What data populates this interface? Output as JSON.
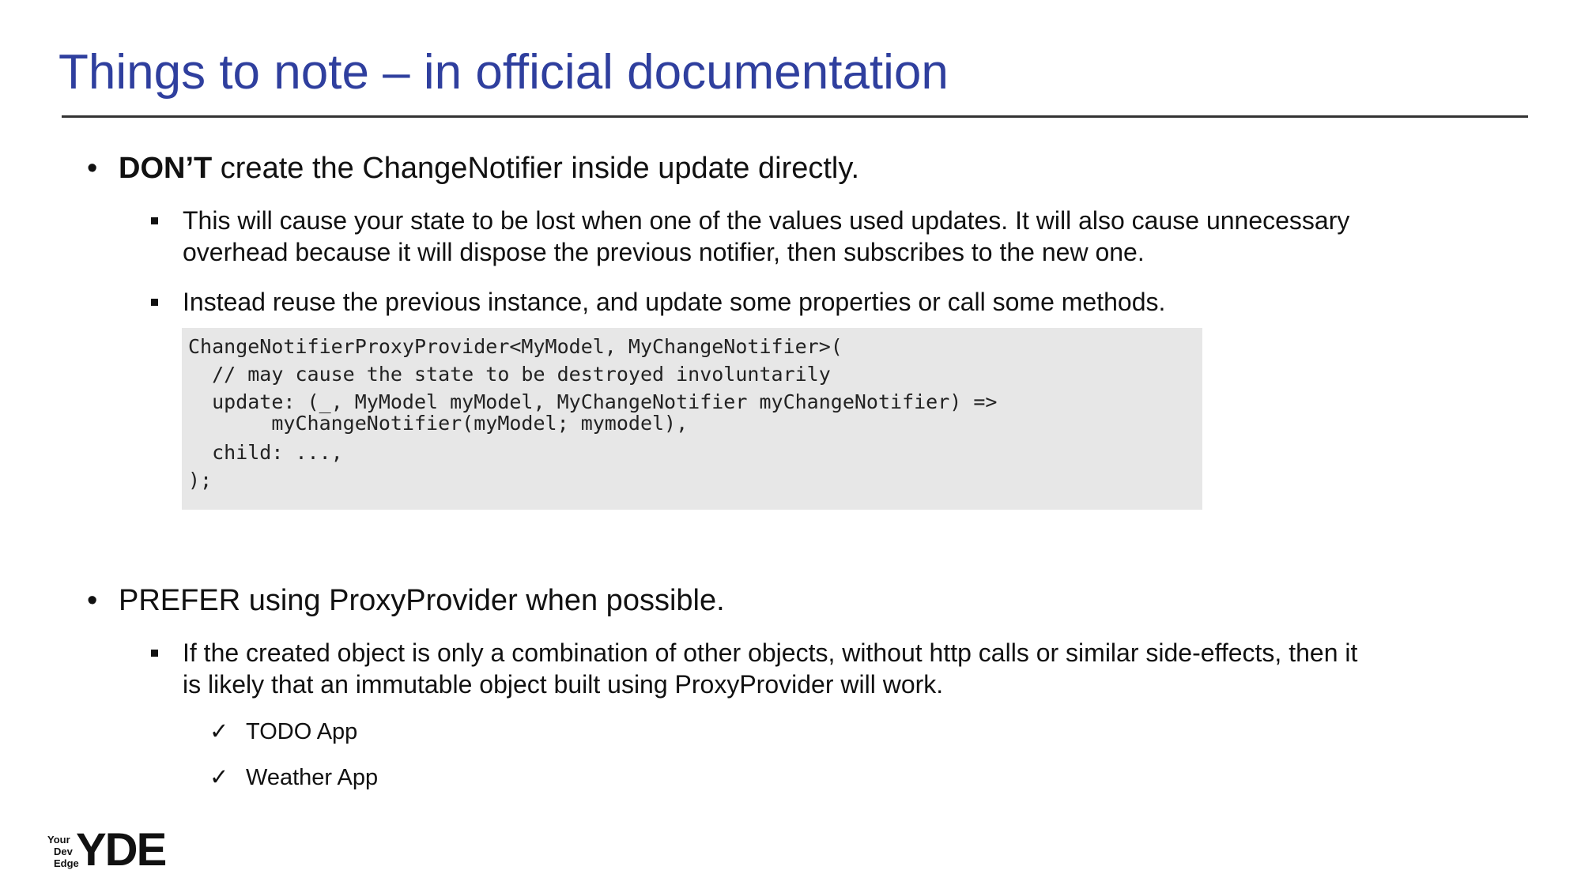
{
  "slide": {
    "title": "Things to note – in official documentation"
  },
  "sections": {
    "dont": {
      "lead": "DON’T",
      "rest": " create the ChangeNotifier inside update directly.",
      "sub1_line1": "This will cause your state to be lost when one of the values used updates. It will also cause unnecessary",
      "sub1_line2": "overhead because it will dispose the previous notifier, then subscribes to the new one.",
      "sub2": "Instead reuse the previous instance, and update some properties or call some methods."
    },
    "code": {
      "lines": [
        "ChangeNotifierProxyProvider<MyModel, MyChangeNotifier>(",
        "  // may cause the state to be destroyed involuntarily",
        "  update: (_, MyModel myModel, MyChangeNotifier myChangeNotifier) =>",
        "       myChangeNotifier(myModel; mymodel),",
        "  child: ...,",
        ");"
      ]
    },
    "prefer": {
      "text": "PREFER using ProxyProvider when possible.",
      "sub1_line1": "If the created object is only a combination of other objects, without http calls or similar side-effects, then it",
      "sub1_line2": "is likely that an immutable object built using ProxyProvider will work.",
      "checkmark": "✓",
      "examples": [
        "TODO App",
        "Weather App"
      ]
    }
  },
  "logo": {
    "small_lines": [
      "Your",
      "Dev",
      "Edge"
    ],
    "mark": "YDE"
  }
}
